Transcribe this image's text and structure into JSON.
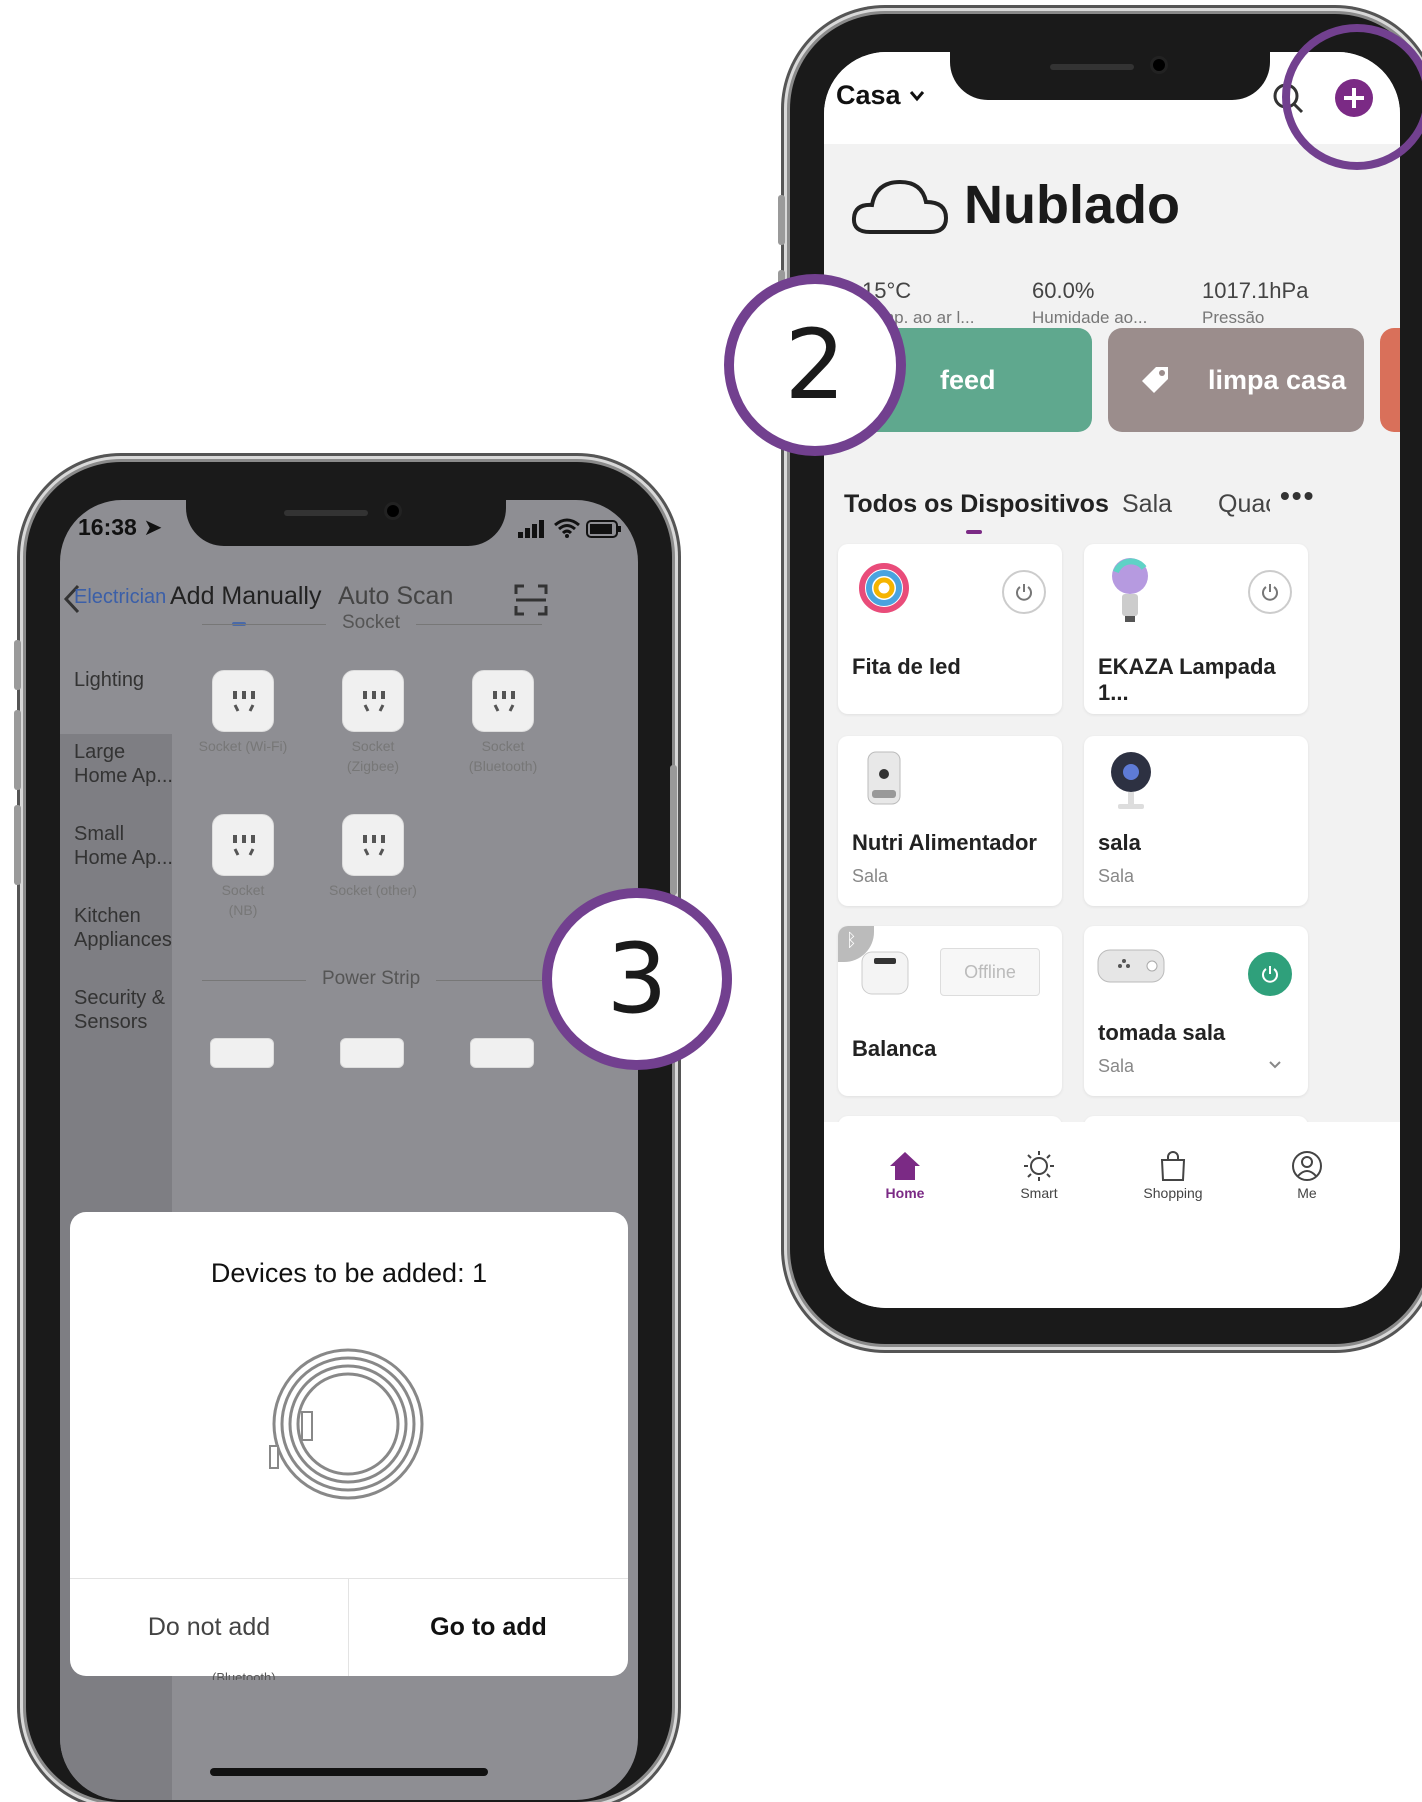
{
  "right_phone": {
    "home_selector": "Casa",
    "weather": {
      "condition": "Nublado",
      "stats": [
        {
          "value": "15°C",
          "label": "Temp. ao ar l..."
        },
        {
          "value": "60.0%",
          "label": "Humidade ao..."
        },
        {
          "value": "1017.1hPa",
          "label": "Pressão"
        }
      ]
    },
    "scenes": [
      {
        "label": "feed",
        "color": "#5fa88e"
      },
      {
        "label": "limpa casa",
        "color": "#9b8d8c"
      }
    ],
    "room_tabs": [
      "Todos os Dispositivos",
      "Sala",
      "Quac"
    ],
    "devices": [
      {
        "name": "Fita de led",
        "room": ""
      },
      {
        "name": "EKAZA Lampada 1...",
        "room": ""
      },
      {
        "name": "Nutri Alimentador",
        "room": "Sala"
      },
      {
        "name": "sala",
        "room": "Sala"
      },
      {
        "name": "Balanca",
        "room": "",
        "status": "Offline"
      },
      {
        "name": "tomada sala",
        "room": "Sala"
      }
    ],
    "bottom_nav": [
      "Home",
      "Smart",
      "Shopping",
      "Me"
    ],
    "accent": "#7b2a85",
    "on_color": "#2fa07b"
  },
  "left_phone": {
    "status_time": "16:38",
    "tabs": [
      "Add Manually",
      "Auto Scan"
    ],
    "categories": [
      "Electrician",
      "Lighting",
      "Large Home Ap...",
      "Small Home Ap...",
      "Kitchen Appliances",
      "Security & Sensors"
    ],
    "sections": [
      "Socket",
      "Power Strip"
    ],
    "sockets": [
      {
        "line1": "Socket (Wi-Fi)",
        "line2": ""
      },
      {
        "line1": "Socket",
        "line2": "(Zigbee)"
      },
      {
        "line1": "Socket",
        "line2": "(Bluetooth)"
      },
      {
        "line1": "Socket",
        "line2": "(NB)"
      },
      {
        "line1": "Socket (other)",
        "line2": ""
      }
    ],
    "dialog": {
      "title": "Devices to be added: 1",
      "cancel": "Do not add",
      "confirm": "Go to add"
    },
    "partial_text": "(Bluetooth)"
  },
  "step_markers": [
    "2",
    "3"
  ]
}
